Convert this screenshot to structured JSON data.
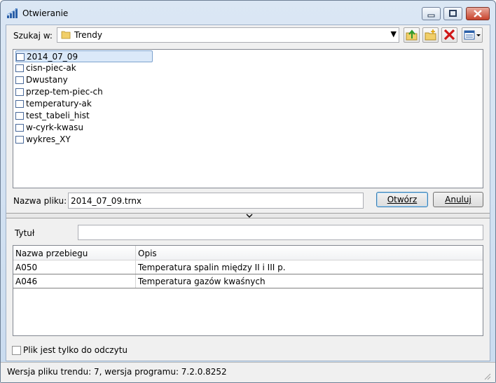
{
  "window": {
    "title": "Otwieranie"
  },
  "lookin": {
    "label": "Szukaj w:",
    "value": "Trendy"
  },
  "toolbar": {
    "up_icon": "folder-up-icon",
    "new_folder_icon": "new-folder-icon",
    "delete_icon": "delete-icon",
    "view_icon": "view-menu-icon"
  },
  "files": [
    {
      "name": "2014_07_09",
      "selected": true
    },
    {
      "name": "cisn-piec-ak"
    },
    {
      "name": "Dwustany"
    },
    {
      "name": "przep-tem-piec-ch"
    },
    {
      "name": "temperatury-ak"
    },
    {
      "name": "test_tabeli_hist"
    },
    {
      "name": "w-cyrk-kwasu"
    },
    {
      "name": "wykres_XY"
    }
  ],
  "filename": {
    "label": "Nazwa pliku:",
    "value": "2014_07_09.trnx"
  },
  "buttons": {
    "open": "Otwórz",
    "cancel": "Anuluj"
  },
  "title_field": {
    "label": "Tytuł",
    "value": ""
  },
  "table": {
    "columns": [
      "Nazwa przebiegu",
      "Opis"
    ],
    "rows": [
      [
        "A050",
        "Temperatura spalin między II i III p."
      ],
      [
        "A046",
        "Temperatura gazów kwaśnych"
      ]
    ]
  },
  "readonly": {
    "label": "Plik jest tylko do odczytu",
    "checked": false
  },
  "status": {
    "text": "Wersja pliku trendu: 7, wersja programu: 7.2.0.8252"
  }
}
